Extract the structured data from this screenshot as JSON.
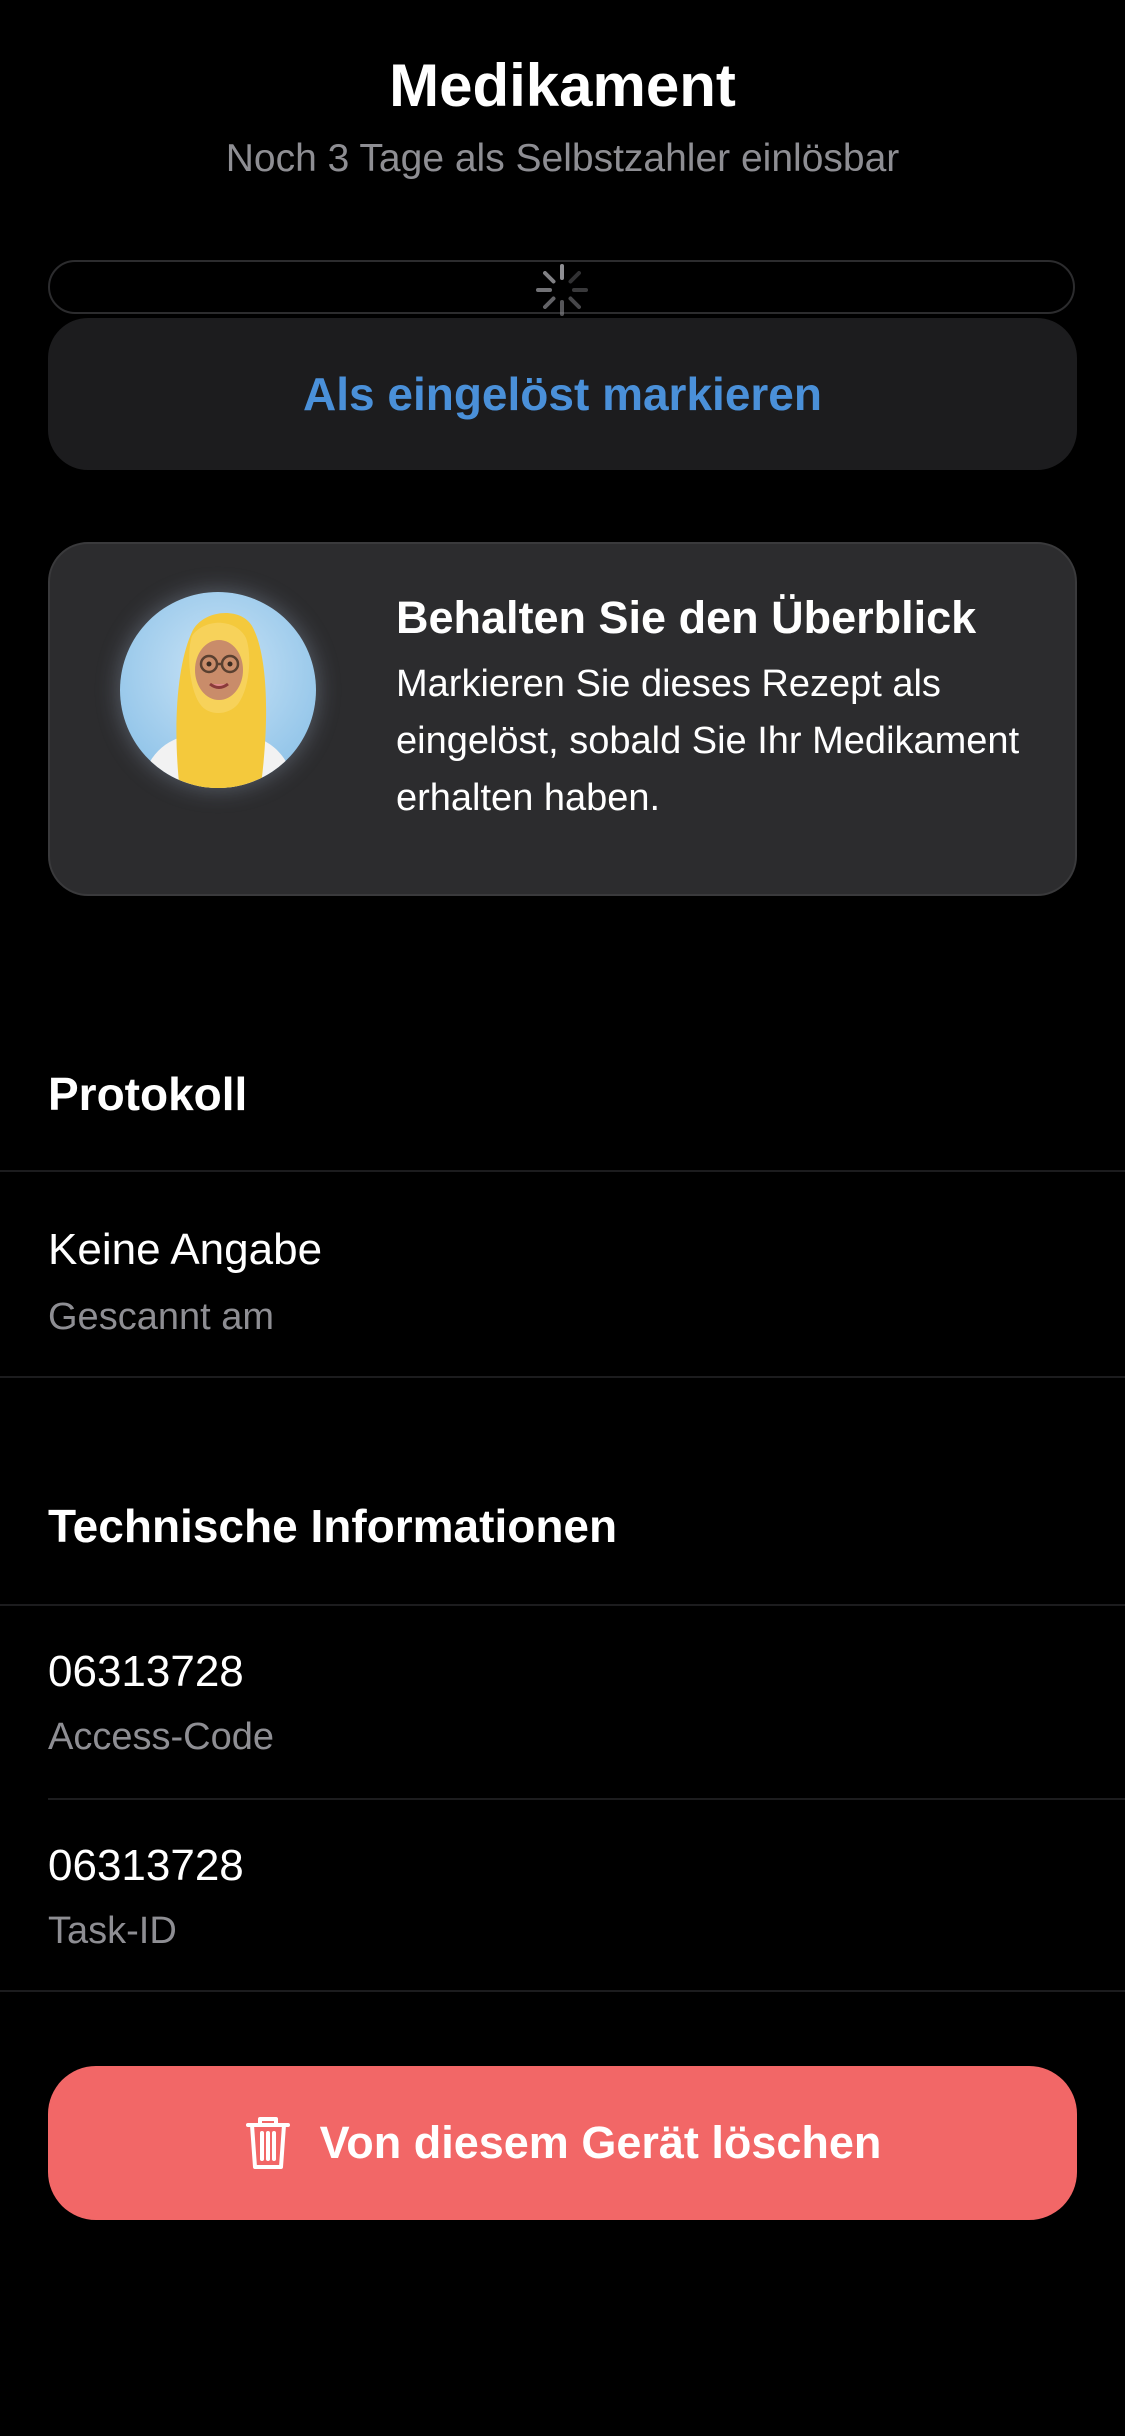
{
  "header": {
    "title": "Medikament",
    "subtitle": "Noch 3 Tage als Selbstzahler einlösbar"
  },
  "mark_button": {
    "label": "Als eingelöst markieren"
  },
  "hint_card": {
    "title": "Behalten Sie den Überblick",
    "body": "Markieren Sie dieses Rezept als eingelöst, sobald Sie Ihr Medikament erhalten haben.",
    "avatar_icon": "pharmacist-avatar"
  },
  "protocol": {
    "header": "Protokoll",
    "rows": [
      {
        "value": "Keine Angabe",
        "label": "Gescannt am"
      }
    ]
  },
  "technical": {
    "header": "Technische Informationen",
    "rows": [
      {
        "value": "06313728",
        "label": "Access-Code"
      },
      {
        "value": "06313728",
        "label": "Task-ID"
      }
    ]
  },
  "delete_button": {
    "label": "Von diesem Gerät löschen",
    "icon": "trash-icon"
  },
  "colors": {
    "background": "#000000",
    "card": "#1c1c1e",
    "hint_card": "#2c2c2e",
    "accent_blue": "#4a90d9",
    "secondary_text": "#8e8e93",
    "destructive": "#f26767"
  }
}
